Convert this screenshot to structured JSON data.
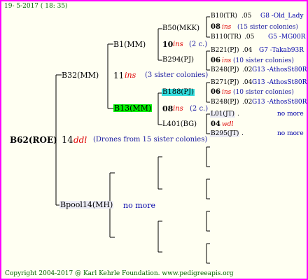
{
  "header": {
    "date": "19-  5-2017 ( 18: 35)"
  },
  "footer": {
    "copyright": "Copyright 2004-2017 @ Karl Kehrle Foundation.   www.pedigreeapis.org"
  },
  "root": {
    "label": "B62(ROE)",
    "num": "14",
    "ins": "ddl",
    "note": "(Drones from 15 sister colonies)"
  },
  "gen1": {
    "upper": {
      "label": "B32(MM)",
      "num": "11",
      "ins": "ins",
      "note": "(3 sister colonies)"
    },
    "lower": {
      "label": "Bpool14(MH)",
      "note": "no more"
    }
  },
  "gen2": {
    "a": {
      "label": "B1(MM)",
      "num": "10",
      "ins": "ins",
      "note": "(2 c.)"
    },
    "b": {
      "label": "B13(MM)",
      "num": "08",
      "ins": "ins",
      "note": "(2 c.)"
    }
  },
  "gen3": {
    "a": {
      "label": "B50(MKK)"
    },
    "b": {
      "label": "B294(PJ)"
    },
    "c": {
      "label": "B188(PJ)"
    },
    "d": {
      "label": "L401(BG)"
    }
  },
  "gen4": [
    {
      "label": "B10(TR)",
      "num": ".05",
      "extra": "G8 -Old_Lady"
    },
    {
      "num": "08",
      "ins": "ins",
      "note": "(15 sister colonies)"
    },
    {
      "label": "B110(TR)",
      "num": ".05",
      "extra": "G5 -MG00R"
    },
    {
      "label": "B221(PJ)",
      "num": ".04",
      "extra": "G7 -Takab93R"
    },
    {
      "num": "06",
      "ins": "ins",
      "note": "(10 sister colonies)"
    },
    {
      "label": "B248(PJ)",
      "num": ".02",
      "extra": "G13 -AthosSt80R"
    },
    {
      "label": "B271(PJ)",
      "num": ".04",
      "extra": "G13 -AthosSt80R"
    },
    {
      "num": "06",
      "ins": "ins",
      "note": "(10 sister colonies)"
    },
    {
      "label": "B248(PJ)",
      "num": ".02",
      "extra": "G13 -AthosSt80R"
    },
    {
      "label": "L01(JT)",
      "num": ".",
      "extra": "no more"
    },
    {
      "num": "04",
      "ins": "wdl"
    },
    {
      "label": "B295(JT)",
      "num": ".",
      "extra": "no more"
    }
  ]
}
